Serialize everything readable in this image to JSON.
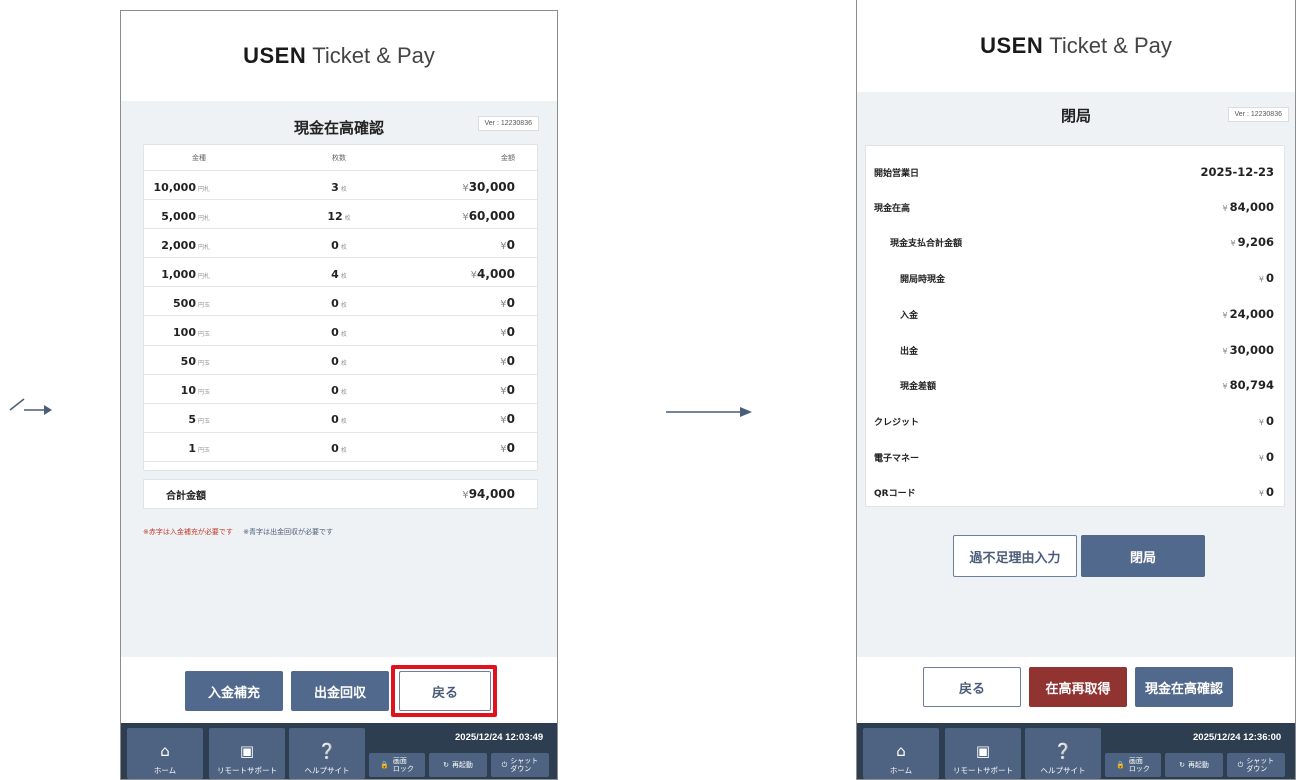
{
  "left_screen": {
    "brand": {
      "bold": "USEN",
      "rest": "Ticket & Pay"
    },
    "title": "現金在高確認",
    "version": "Ver : 12230836",
    "table_headers": {
      "kind": "金種",
      "count": "枚数",
      "amount": "金額"
    },
    "rows": [
      {
        "denom": "10,000",
        "unit": "円札",
        "count": "3",
        "count_unit": "枚",
        "yen": "¥",
        "amount": "30,000"
      },
      {
        "denom": "5,000",
        "unit": "円札",
        "count": "12",
        "count_unit": "枚",
        "yen": "¥",
        "amount": "60,000"
      },
      {
        "denom": "2,000",
        "unit": "円札",
        "count": "0",
        "count_unit": "枚",
        "yen": "¥",
        "amount": "0"
      },
      {
        "denom": "1,000",
        "unit": "円札",
        "count": "4",
        "count_unit": "枚",
        "yen": "¥",
        "amount": "4,000"
      },
      {
        "denom": "500",
        "unit": "円玉",
        "count": "0",
        "count_unit": "枚",
        "yen": "¥",
        "amount": "0"
      },
      {
        "denom": "100",
        "unit": "円玉",
        "count": "0",
        "count_unit": "枚",
        "yen": "¥",
        "amount": "0"
      },
      {
        "denom": "50",
        "unit": "円玉",
        "count": "0",
        "count_unit": "枚",
        "yen": "¥",
        "amount": "0"
      },
      {
        "denom": "10",
        "unit": "円玉",
        "count": "0",
        "count_unit": "枚",
        "yen": "¥",
        "amount": "0"
      },
      {
        "denom": "5",
        "unit": "円玉",
        "count": "0",
        "count_unit": "枚",
        "yen": "¥",
        "amount": "0"
      },
      {
        "denom": "1",
        "unit": "円玉",
        "count": "0",
        "count_unit": "枚",
        "yen": "¥",
        "amount": "0"
      }
    ],
    "total": {
      "label": "合計金額",
      "yen": "¥",
      "value": "94,000"
    },
    "note_red": "※赤字は入金補充が必要です",
    "note_blue": "※青字は出金回収が必要です",
    "buttons": {
      "deposit": "入金補充",
      "withdraw": "出金回収",
      "back": "戻る"
    },
    "highlight_color": "#e2121c",
    "datetime": "2025/12/24 12:03:49"
  },
  "right_screen": {
    "brand": {
      "bold": "USEN",
      "rest": "Ticket & Pay"
    },
    "title": "閉局",
    "version": "Ver : 12230836",
    "items": [
      {
        "label": "開始営業日",
        "value": "2025-12-23",
        "yen": ""
      },
      {
        "label": "現金在高",
        "value": "84,000",
        "yen": "¥"
      },
      {
        "label": "現金支払合計金額",
        "value": "9,206",
        "yen": "¥"
      },
      {
        "label": "開局時現金",
        "value": "0",
        "yen": "¥"
      },
      {
        "label": "入金",
        "value": "24,000",
        "yen": "¥"
      },
      {
        "label": "出金",
        "value": "30,000",
        "yen": "¥"
      },
      {
        "label": "現金差額",
        "value": "80,794",
        "yen": "¥"
      },
      {
        "label": "クレジット",
        "value": "0",
        "yen": "¥"
      },
      {
        "label": "電子マネー",
        "value": "0",
        "yen": "¥"
      },
      {
        "label": "QRコード",
        "value": "0",
        "yen": "¥"
      }
    ],
    "buttons": {
      "reason": "過不足理由入力",
      "close": "閉局",
      "back": "戻る",
      "reacquire": "在高再取得",
      "cash_check": "現金在高確認"
    },
    "datetime": "2025/12/24 12:36:00"
  },
  "taskbar": {
    "home": "ホーム",
    "remote": "リモートサポート",
    "help": "ヘルプサイト",
    "lock": "画面\nロック",
    "restart": "再起動",
    "shutdown": "シャット\nダウン",
    "icons": {
      "home": "home-icon",
      "remote": "remote-support-icon",
      "help": "help-icon",
      "lock": "lock-icon",
      "restart": "restart-icon",
      "power": "power-icon"
    }
  },
  "colors": {
    "primary": "#51698c",
    "danger": "#913331",
    "taskbar": "#2c3e50",
    "arrow": "#4a5d79"
  }
}
